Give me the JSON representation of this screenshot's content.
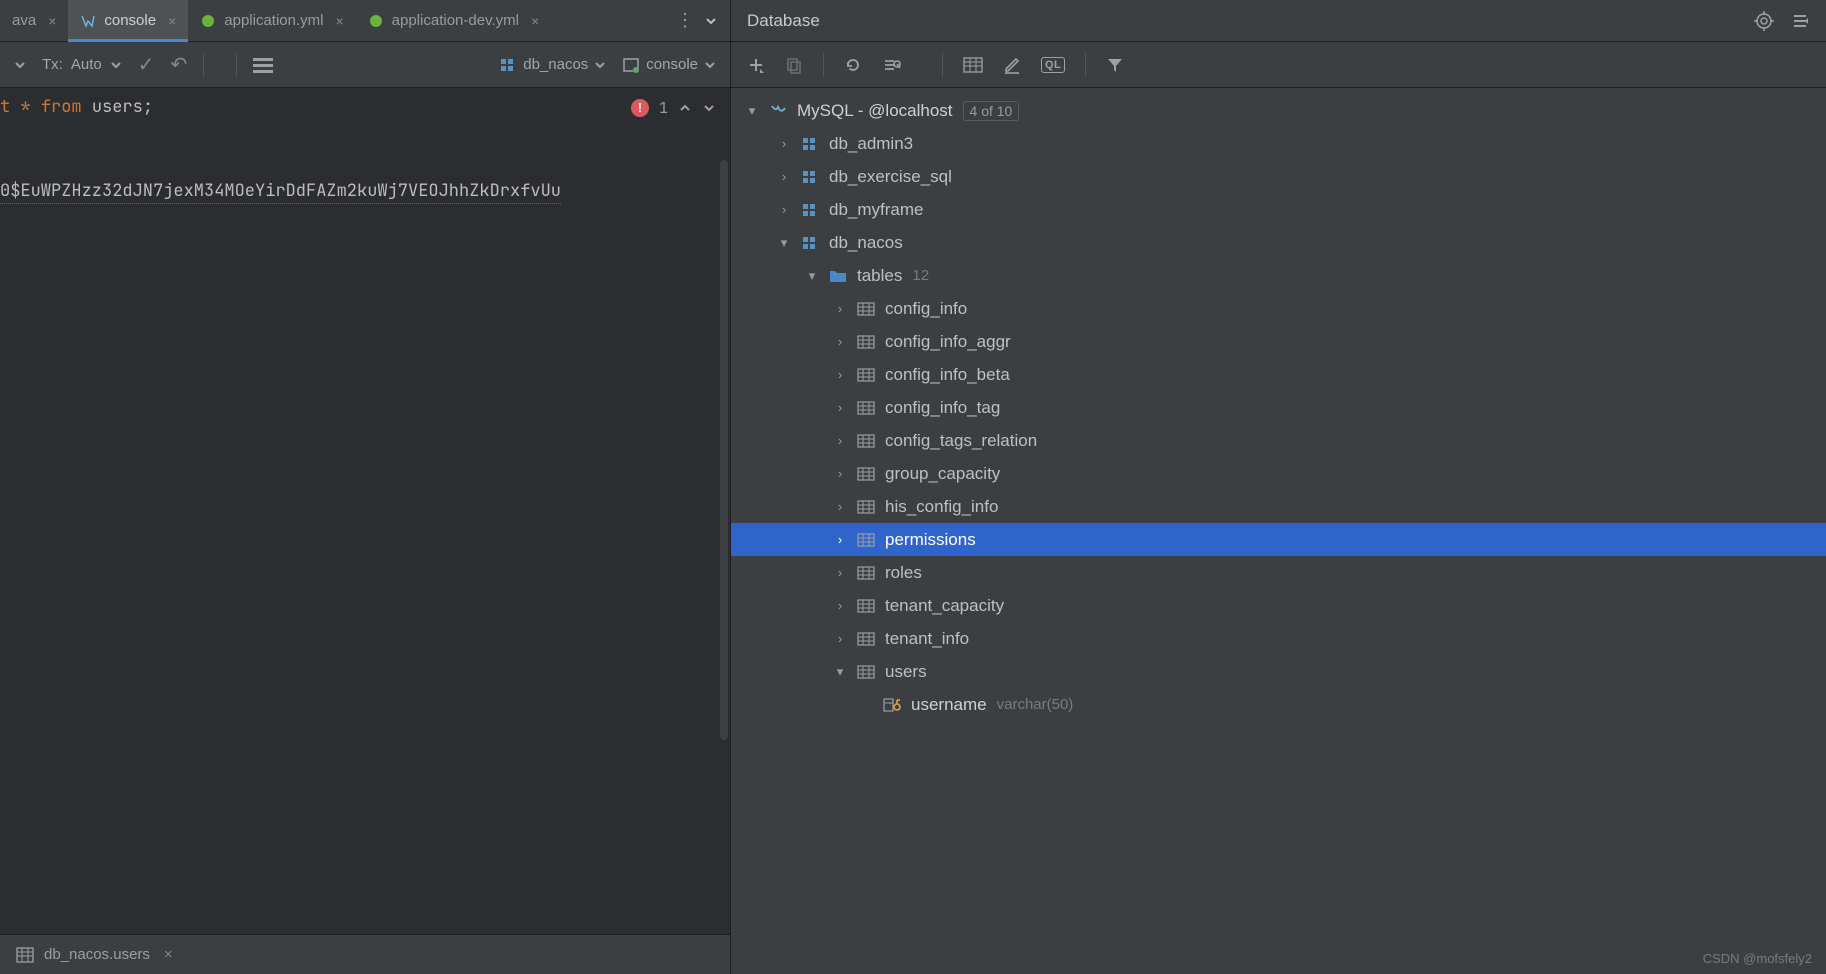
{
  "tabs": [
    {
      "label": "ava",
      "icon": "java",
      "active": false
    },
    {
      "label": "console",
      "icon": "sql",
      "active": true
    },
    {
      "label": "application.yml",
      "icon": "spring",
      "active": false
    },
    {
      "label": "application-dev.yml",
      "icon": "spring",
      "active": false
    }
  ],
  "editor_toolbar": {
    "tx_label": "Tx:",
    "tx_value": "Auto",
    "db_select": "db_nacos",
    "console_select": "console"
  },
  "editor": {
    "sql_select": "t",
    "sql_star": "*",
    "sql_from": "from",
    "sql_table": "users",
    "sql_semi": ";",
    "result_line": "0$EuWPZHzz32dJN7jexM34MOeYirDdFAZm2kuWj7VEOJhhZkDrxfvUu",
    "error_count": "1"
  },
  "bottom_tab": {
    "label": "db_nacos.users"
  },
  "db_panel": {
    "title": "Database",
    "datasource": "MySQL - @localhost",
    "datasource_badge": "4 of 10",
    "schemas": [
      {
        "name": "db_admin3"
      },
      {
        "name": "db_exercise_sql"
      },
      {
        "name": "db_myframe"
      }
    ],
    "active_schema": "db_nacos",
    "tables_label": "tables",
    "tables_count": "12",
    "tables": [
      "config_info",
      "config_info_aggr",
      "config_info_beta",
      "config_info_tag",
      "config_tags_relation",
      "group_capacity",
      "his_config_info",
      "permissions",
      "roles",
      "tenant_capacity",
      "tenant_info",
      "users"
    ],
    "selected_table": "permissions",
    "expanded_table": "users",
    "column": {
      "name": "username",
      "type": "varchar(50)"
    }
  },
  "ql_label": "QL",
  "watermark": "CSDN @mofsfely2"
}
